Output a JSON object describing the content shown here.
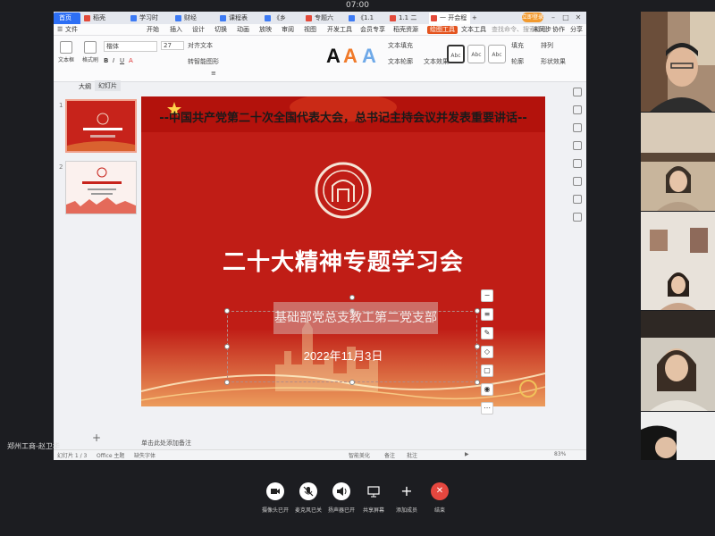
{
  "meeting": {
    "time": "07:00"
  },
  "tabs": [
    {
      "label": "首页",
      "color": "#2d6ff5"
    },
    {
      "label": "稻壳",
      "color": "#e34a3a"
    },
    {
      "label": "学习时",
      "color": "#3d7bf5"
    },
    {
      "label": "财经",
      "color": "#3d7bf5"
    },
    {
      "label": "课程表",
      "color": "#3d7bf5"
    },
    {
      "label": "《乡",
      "color": "#3d7bf5"
    },
    {
      "label": "专题六",
      "color": "#e34a3a"
    },
    {
      "label": "《1.1",
      "color": "#3d7bf5"
    },
    {
      "label": "1.1 二",
      "color": "#e34a3a"
    },
    {
      "label": "一 开会程",
      "color": "#e34a3a"
    }
  ],
  "tab_login": "立即登录",
  "menus": [
    "文件",
    "开始",
    "插入",
    "设计",
    "切换",
    "动画",
    "放映",
    "审阅",
    "视图",
    "开发工具",
    "会员专享",
    "稻壳资源",
    "绘图工具",
    "文本工具"
  ],
  "menu_active": "绘图工具",
  "menu_right": [
    "未同步",
    "协作",
    "分享"
  ],
  "search_placeholder": "查找命令、搜索模板",
  "ribbon": {
    "textbox": "文本框",
    "format_painter": "格式刷",
    "font": "楷体",
    "size": "27",
    "align_text": "对齐文本",
    "smart_graphic": "转智能图形",
    "fill": "文本填充",
    "outline": "文本轮廓",
    "effect": "文本效果",
    "shape_fill": "填充",
    "shape_outline": "轮廓",
    "shape_effect": "形状效果",
    "arrange": "排列",
    "select": "选择窗格",
    "abc": [
      "Abc",
      "Abc",
      "Abc"
    ]
  },
  "panel_tabs": {
    "outline": "大纲",
    "slides": "幻灯片"
  },
  "slide": {
    "header": "--中国共产党第二十次全国代表大会，总书记主持会议并发表重要讲话--",
    "title": "二十大精神专题学习会",
    "subtitle": "基础部党总支教工第二党支部",
    "date": "2022年11月3日"
  },
  "notes_placeholder": "单击此处添加备注",
  "status": {
    "slide_info": "幻灯片 1 / 3",
    "theme": "Office 主题",
    "missing_font": "缺失字体",
    "smart_beautify": "智能美化",
    "notes": "备注",
    "comments": "批注",
    "zoom": "83%"
  },
  "presenter_label": "郑州工商-赵卫华",
  "controls": [
    {
      "label": "摄像头已开",
      "icon": "camera-icon"
    },
    {
      "label": "麦克风已关",
      "icon": "mic-off-icon"
    },
    {
      "label": "扬声器已开",
      "icon": "speaker-icon"
    },
    {
      "label": "共享屏幕",
      "icon": "share-screen-icon"
    },
    {
      "label": "添加成员",
      "icon": "add-member-icon"
    },
    {
      "label": "结束",
      "icon": "end-call-icon"
    }
  ]
}
